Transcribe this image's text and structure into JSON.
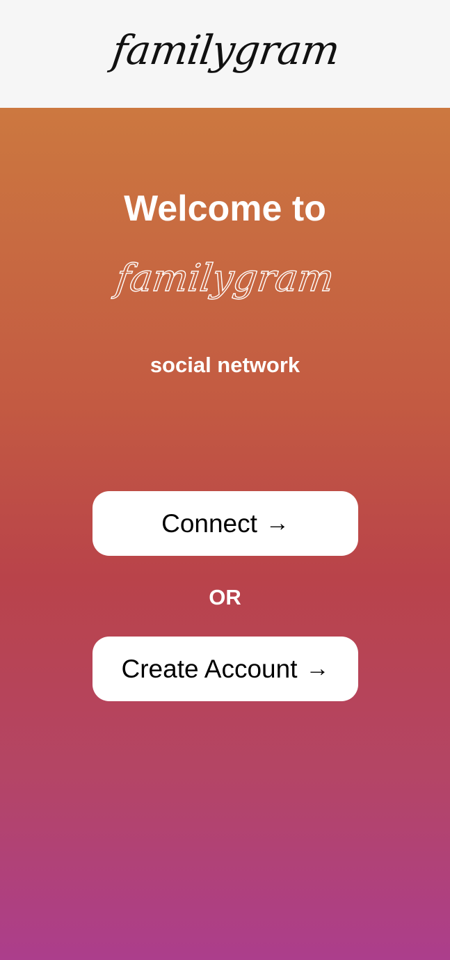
{
  "header": {
    "brand": "familygram"
  },
  "welcome": {
    "title": "Welcome to",
    "brand": "familygram",
    "tagline": "social network"
  },
  "actions": {
    "connect_label": "Connect",
    "separator": "OR",
    "create_label": "Create Account",
    "arrow_icon": "arrow-right-icon"
  },
  "colors": {
    "header_bg": "#f6f6f6",
    "gradient_top": "#cc7840",
    "gradient_mid": "#b9434a",
    "gradient_bottom": "#ac3e8c",
    "button_bg": "#ffffff"
  }
}
